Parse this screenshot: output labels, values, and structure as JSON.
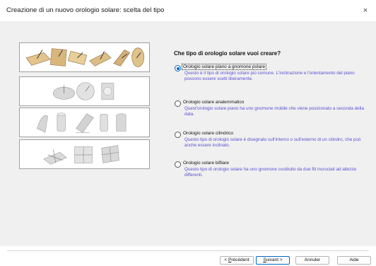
{
  "window": {
    "title": "Creazione di un nuovo orologio solare: scelta del tipo",
    "close_glyph": "×"
  },
  "question": "Che tipo di orologio solare vuoi creare?",
  "options": [
    {
      "label": "Orologio solare piano a gnomone polare",
      "description": "Questo è il tipo di orologio solare più comune. L'inclinazione e l'orientamento del piano possono essere scelti liberamente.",
      "selected": true
    },
    {
      "label": "Orologio solare analemmatico",
      "description": "Quest'orologio solare piano ha uno gnomone mobile che viene posizionato a seconda della data.",
      "selected": false
    },
    {
      "label": "Orologio solare cilindrico",
      "description": "Questo tipo di orologio solare è disegnato sull'interno o sull'esterno di un cilindro, che può anche essere inclinato.",
      "selected": false
    },
    {
      "label": "Orologio solare bifilare",
      "description": "Questo tipo di orologio solare ha uno gnomone costituito da due fili incrociati ad altezze differenti.",
      "selected": false
    }
  ],
  "buttons": {
    "prev_underlined": "P",
    "prev_rest": "récédent",
    "prev_prefix": "< ",
    "next_underlined": "S",
    "next_rest": "uivant",
    "next_suffix": " >",
    "cancel": "Annuler",
    "help": "Aide"
  },
  "colors": {
    "accent": "#0067c0",
    "description_text": "#5a4fd2",
    "panel_bg": "#f0f0f0"
  },
  "icons": {
    "close": "close-icon",
    "thumbnails": [
      "planar-sundial-thumbnails",
      "analemmatic-sundial-thumbnails",
      "cylindrical-sundial-thumbnails",
      "bifilar-sundial-thumbnails"
    ]
  }
}
